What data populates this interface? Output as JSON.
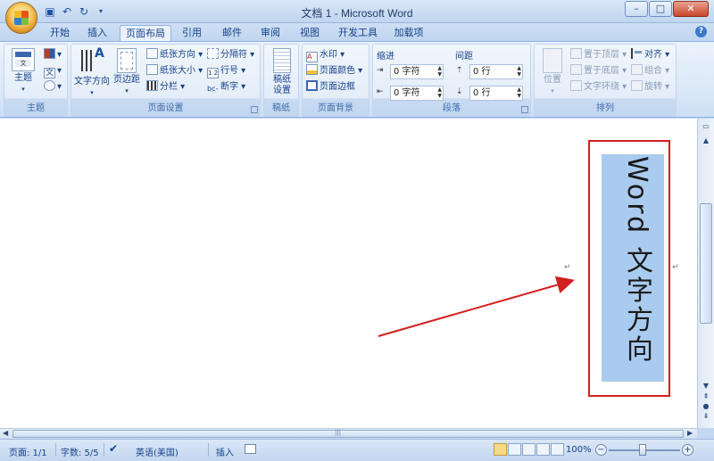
{
  "window": {
    "title": "文档 1 - Microsoft Word"
  },
  "qat": {
    "save_icon": "save-icon",
    "undo_icon": "undo-icon",
    "redo_icon": "redo-icon",
    "more_icon": "customize-qat-icon"
  },
  "window_controls": {
    "minimize": "–",
    "maximize": "□",
    "close": "✕"
  },
  "tabs": [
    {
      "label": "开始"
    },
    {
      "label": "插入"
    },
    {
      "label": "页面布局",
      "active": true
    },
    {
      "label": "引用"
    },
    {
      "label": "邮件"
    },
    {
      "label": "审阅"
    },
    {
      "label": "视图"
    },
    {
      "label": "开发工具"
    },
    {
      "label": "加载项"
    }
  ],
  "ribbon": {
    "theme_group": {
      "label": "主题",
      "theme_button": "主题"
    },
    "page_setup_group": {
      "label": "页面设置",
      "text_direction": "文字方向",
      "margins": "页边距",
      "orientation": "纸张方向",
      "size": "纸张大小",
      "columns": "分栏",
      "breaks": "分隔符",
      "line_numbers": "行号",
      "hyphenation": "断字"
    },
    "manuscript_group": {
      "label": "稿纸",
      "button": "稿纸\n设置",
      "button_line1": "稿纸",
      "button_line2": "设置"
    },
    "background_group": {
      "label": "页面背景",
      "watermark": "水印",
      "page_color": "页面颜色",
      "page_borders": "页面边框"
    },
    "paragraph_group": {
      "label": "段落",
      "indent_label": "缩进",
      "spacing_label": "间距",
      "indent_left": "0 字符",
      "indent_right": "0 字符",
      "spacing_before": "0 行",
      "spacing_after": "0 行"
    },
    "arrange_group": {
      "label": "排列",
      "position": "位置",
      "bring_front": "置于顶层",
      "send_back": "置于底层",
      "text_wrap": "文字环绕",
      "align": "对齐",
      "group": "组合",
      "rotate": "旋转"
    }
  },
  "document": {
    "vertical_text": "Word 文字方向"
  },
  "statusbar": {
    "page": "页面: 1/1",
    "words": "字数: 5/5",
    "language": "英语(美国)",
    "insert_mode": "插入",
    "zoom": "100%"
  },
  "colors": {
    "annotation_red": "#d21f1f",
    "selection_blue": "#a9cbef",
    "ribbon_text": "#15428b"
  }
}
